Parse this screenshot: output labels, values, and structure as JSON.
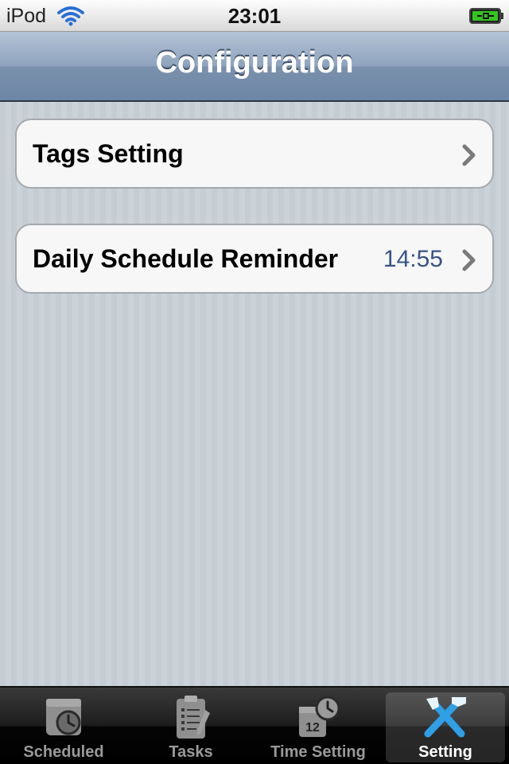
{
  "status_bar": {
    "carrier": "iPod",
    "time": "23:01",
    "wifi_icon": "wifi-icon",
    "battery_icon": "battery-charging-icon"
  },
  "nav": {
    "title": "Configuration"
  },
  "cells": [
    {
      "label": "Tags Setting",
      "value": "",
      "icon": "chevron-right-icon"
    },
    {
      "label": "Daily Schedule Reminder",
      "value": "14:55",
      "icon": "chevron-right-icon"
    }
  ],
  "tabs": [
    {
      "label": "Scheduled",
      "icon": "clock-icon",
      "selected": false
    },
    {
      "label": "Tasks",
      "icon": "clipboard-icon",
      "selected": false
    },
    {
      "label": "Time Setting",
      "icon": "calendar-clock-icon",
      "selected": false
    },
    {
      "label": "Setting",
      "icon": "tools-icon",
      "selected": true
    }
  ],
  "colors": {
    "accent_value": "#385487",
    "background": "#c5ccd4",
    "nav_bar": "#7a91ad",
    "battery_green": "#34c520"
  }
}
